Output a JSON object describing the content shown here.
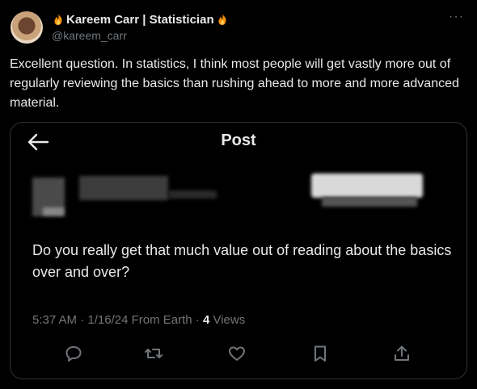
{
  "header": {
    "display_name": "Kareem Carr | Statistician",
    "handle": "@kareem_carr",
    "more_label": "···"
  },
  "tweet": {
    "text": "Excellent question. In statistics, I think most people will get vastly more out of regularly reviewing the basics than rushing ahead to more and more advanced material."
  },
  "quoted_post": {
    "title": "Post",
    "text": "Do you really get that much value out of reading about the basics over and over?",
    "time": "5:37 AM",
    "date": "1/16/24",
    "source": "From Earth",
    "views_count": "4",
    "views_label": "Views",
    "separator": "·"
  },
  "icons": {
    "back": "arrow-left-icon",
    "reply": "reply-icon",
    "repost": "repost-icon",
    "like": "like-icon",
    "bookmark": "bookmark-icon",
    "share": "share-icon"
  },
  "colors": {
    "background": "#000000",
    "text": "#e7e9ea",
    "muted": "#71767b",
    "border": "#2f3336"
  }
}
